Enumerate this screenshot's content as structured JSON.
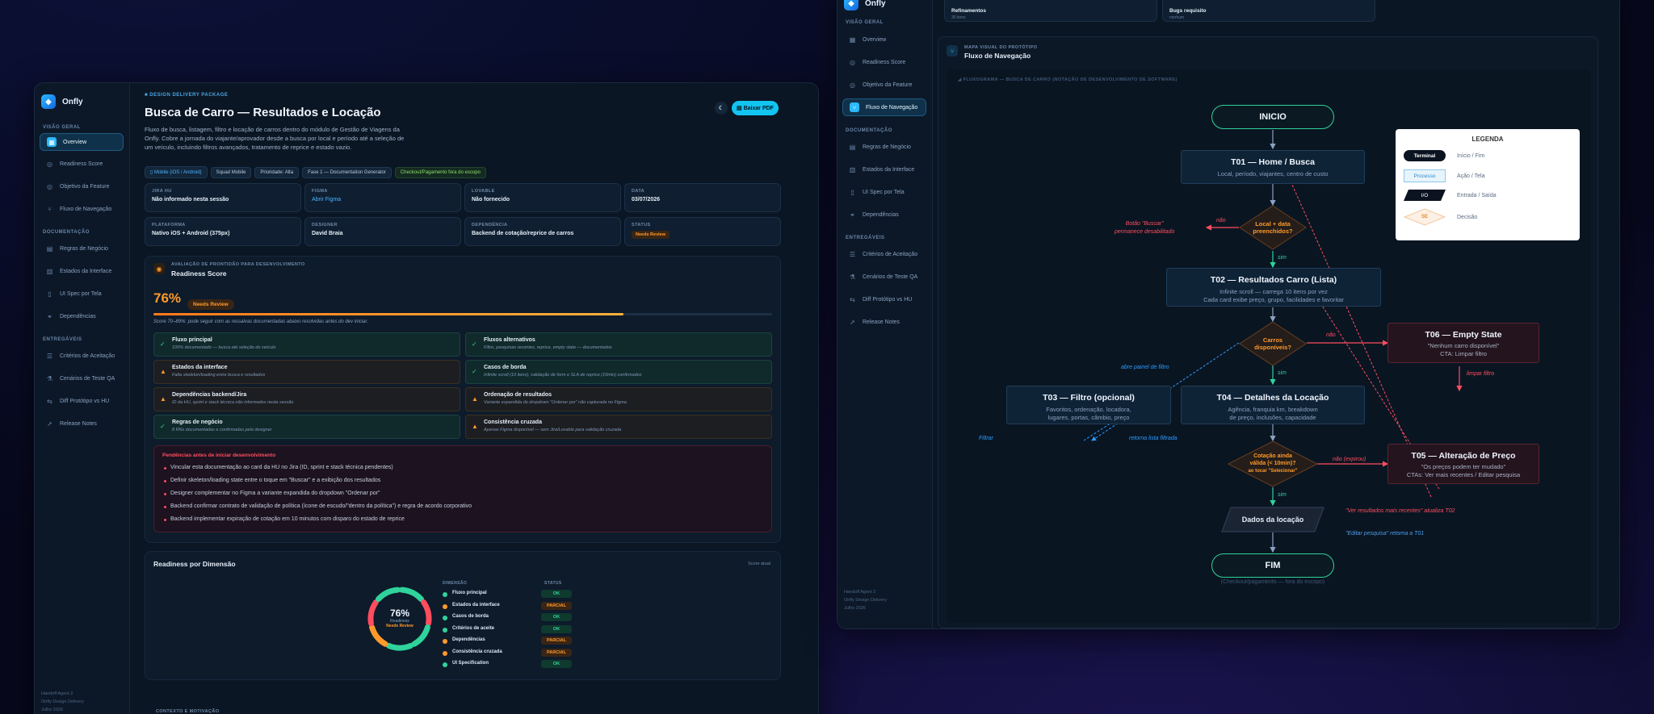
{
  "app": {
    "name": "Onfly"
  },
  "nav": {
    "sec_geral": "VISÃO GERAL",
    "sec_doc": "DOCUMENTAÇÃO",
    "sec_ent": "ENTREGÁVEIS",
    "items": [
      "Overview",
      "Readiness Score",
      "Objetivo da Feature",
      "Fluxo de Navegação",
      "Regras de Negócio",
      "Estados da Interface",
      "UI Spec por Tela",
      "Dependências",
      "Critérios de Aceitação",
      "Cenários de Teste QA",
      "Diff Protótipo vs HU",
      "Release Notes"
    ],
    "footer": [
      "Handoff Agent 2",
      "Onfly Design Delivery",
      "Julho 2026"
    ]
  },
  "header": {
    "tag": "DESIGN DELIVERY PACKAGE",
    "title": "Busca de Carro — Resultados e Locação",
    "desc1": "Fluxo de busca, listagem, filtro e locação de carros dentro do módulo de Gestão de Viagens da",
    "desc2": "Onfly. Cobre a jornada do viajante/aprovador desde a busca por local e período até a seleção de",
    "desc3": "um veículo, incluindo filtros avançados, tratamento de reprice e estado vazio.",
    "chips": [
      "Mobile (iOS / Android)",
      "Squad Mobile",
      "Prioridade: Alta",
      "Fase 1 — Documentation Generator",
      "Checkout/Pagamento fora do escopo"
    ],
    "pdf": "Baixar PDF",
    "pdf_icon": "file-icon",
    "theme_icon": "moon-icon"
  },
  "meta": [
    {
      "label": "JIRA HU",
      "value": "Não informado nesta sessão"
    },
    {
      "label": "FIGMA",
      "value": "Abrir Figma"
    },
    {
      "label": "LOVABLE",
      "value": "Não fornecido"
    },
    {
      "label": "DATA",
      "value": "03/07/2026"
    },
    {
      "label": "PLATAFORMA",
      "value": "Nativo iOS + Android (375px)"
    },
    {
      "label": "DESIGNER",
      "value": "David Braia"
    },
    {
      "label": "DEPENDÊNCIA",
      "value": "Backend de cotação/reprice de carros"
    },
    {
      "label": "STATUS",
      "value": "Needs Review"
    }
  ],
  "readiness": {
    "tag": "AVALIAÇÃO DE PRONTIDÃO PARA DESENVOLVIMENTO",
    "title": "Readiness Score",
    "score": "76%",
    "score_value": 76,
    "badge": "Needs Review",
    "note": "Score 70–89%: pode seguir com as ressalvas documentadas abaixo resolvidas antes do dev iniciar.",
    "dims": [
      {
        "t": "Fluxo principal",
        "s": "100% documentado — busca até seleção do veículo",
        "ok": true
      },
      {
        "t": "Fluxos alternativos",
        "s": "Filtro, pesquisas recentes, reprice, empty state — documentados",
        "ok": true
      },
      {
        "t": "Estados da interface",
        "s": "Falta skeleton/loading entre busca e resultados",
        "ok": false
      },
      {
        "t": "Casos de borda",
        "s": "Infinite scroll (10 itens), validação de form e SLA de reprice (10min) confirmados",
        "ok": true
      },
      {
        "t": "Dependências backend/Jira",
        "s": "ID da HU, sprint e stack técnica não informados nesta sessão",
        "ok": false
      },
      {
        "t": "Ordenação de resultados",
        "s": "Variante expandida do dropdown \"Ordenar por\" não capturada no Figma",
        "ok": false
      },
      {
        "t": "Regras de negócio",
        "s": "8 RNs documentadas e confirmadas pelo designer",
        "ok": true
      },
      {
        "t": "Consistência cruzada",
        "s": "Apenas Figma disponível — sem Jira/Lovable para validação cruzada",
        "ok": false
      }
    ]
  },
  "pending": {
    "title": "Pendências antes de iniciar desenvolvimento",
    "items": [
      "Vincular esta documentação ao card da HU no Jira (ID, sprint e stack técnica pendentes)",
      "Definir skeleton/loading state entre o toque em \"Buscar\" e a exibição dos resultados",
      "Designer complementar no Figma a variante expandida do dropdown \"Ordenar por\"",
      "Backend confirmar contrato de validação de política (ícone de escudo/\"dentro da política\") e regra de acordo corporativo",
      "Backend implementar expiração de cotação em 10 minutos com disparo do estado de reprice"
    ]
  },
  "dimension": {
    "title": "Readiness por Dimensão",
    "tag": "Score atual",
    "center": "76%",
    "center_sub": "Readiness",
    "center_badge": "Needs Review",
    "col1": "DIMENSÃO",
    "col2": "STATUS",
    "rows": [
      {
        "n": "Fluxo principal",
        "s": "OK"
      },
      {
        "n": "Estados da interface",
        "s": "PARCIAL"
      },
      {
        "n": "Casos de borda",
        "s": "OK"
      },
      {
        "n": "Critérios de aceite",
        "s": "OK"
      },
      {
        "n": "Dependências",
        "s": "PARCIAL"
      },
      {
        "n": "Consistência cruzada",
        "s": "PARCIAL"
      },
      {
        "n": "UI Specification",
        "s": "OK"
      }
    ]
  },
  "context_tag": "CONTEXTO E MOTIVAÇÃO",
  "win2": {
    "top_cards": [
      {
        "t": "Refinamentos",
        "s": "30 itens"
      },
      {
        "t": "Bugs requisito",
        "s": "nenhum"
      }
    ],
    "tag": "MAPA VISUAL DO PROTÓTIPO",
    "title": "Fluxo de Navegação",
    "flow_tag": "FLUXOGRAMA — BUSCA DE CARRO (NOTAÇÃO DE DESENVOLVIMENTO DE SOFTWARE)"
  },
  "flow": {
    "inicio": "INICIO",
    "fim": "FIM",
    "t01": "T01 — Home / Busca",
    "t01s": "Local, período, viajantes, centro de custo",
    "d1": [
      "Local + data",
      "preenchidos?"
    ],
    "t02": "T02 — Resultados Carro (Lista)",
    "t02s1": "Infinite scroll — carrega 10 itens por vez",
    "t02s2": "Cada card exibe preço, grupo, facilidades e favoritar",
    "d2": [
      "Carros",
      "disponíveis?"
    ],
    "t03": "T03 — Filtro (opcional)",
    "t03s1": "Favoritos, ordenação, locadora,",
    "t03s2": "lugares, portas, câmbio, preço",
    "t04": "T04 — Detalhes da Locação",
    "t04s1": "Agência, franquia km, breakdown",
    "t04s2": "de preço, inclusões, capacidade",
    "t05": "T05 — Alteração de Preço",
    "t05s1": "\"Os preços podem ter mudado\"",
    "t05s2": "CTAs: Ver mais recentes / Editar pesquisa",
    "t06": "T06 — Empty State",
    "t06s1": "\"Nenhum carro disponível\"",
    "t06s2": "CTA: Limpar filtro",
    "d3": [
      "Cotação ainda",
      "válida (< 10min)?",
      "ao tocar \"Selecionar\""
    ],
    "io": "Dados da locação",
    "fora": "(Checkout/pagamento — fora do escopo)",
    "n_botao": "Botão \"Buscar\"",
    "n_botao2": "permanece desabilitado",
    "n_nao": "não",
    "n_sim": "sim",
    "n_nao2": "não",
    "n_sim2": "sim",
    "n_sim3": "sim",
    "n_abre": "abre painel de filtro",
    "n_filtro": "Filtrar",
    "n_retorna": "retorna lista filtrada",
    "n_limpar": "limpar filtro",
    "n_expirou": "não (expirou)",
    "n_ver": "\"Ver resultados mais recentes\" atualiza T02",
    "n_editar": "\"Editar pesquisa\" retorna a T01",
    "colors": {
      "accent": "#2bb8ff",
      "green": "#2fd39b",
      "orange": "#ff9a2a",
      "red": "#ff4d5e"
    }
  },
  "legend": {
    "title": "LEGENDA",
    "rows": [
      {
        "k": "Terminal",
        "v": "Início / Fim"
      },
      {
        "k": "Processo",
        "v": "Ação / Tela"
      },
      {
        "k": "I/O",
        "v": "Entrada / Saída"
      },
      {
        "k": "SE",
        "v": "Decisão"
      }
    ]
  }
}
